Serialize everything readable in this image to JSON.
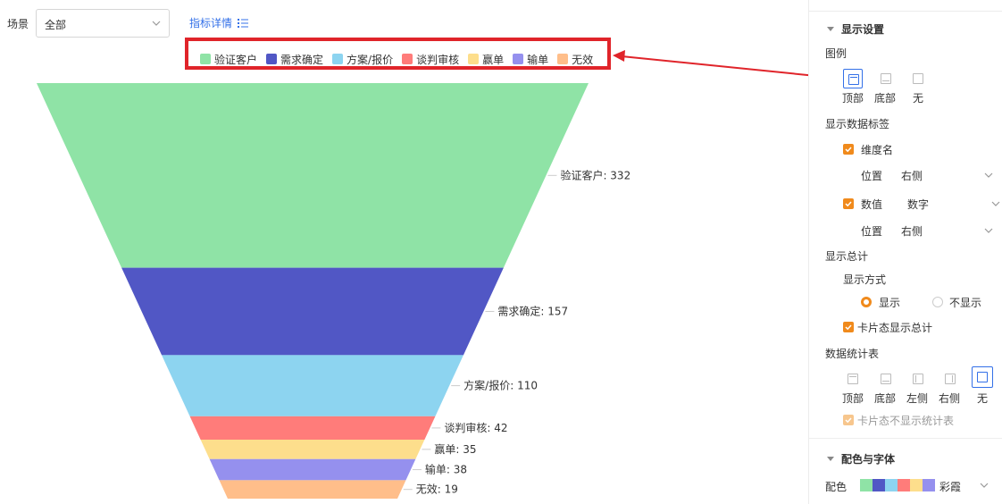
{
  "filter": {
    "label": "场景",
    "value": "全部"
  },
  "detail_link": {
    "label": "指标详情"
  },
  "colors": {
    "accent": "#3370e8",
    "checkbox": "#f08a1c",
    "highlight_box": "#e0242a",
    "annotation_arrow": "#e0242a"
  },
  "chart_data": {
    "type": "funnel",
    "title": "",
    "categories": [
      "验证客户",
      "需求确定",
      "方案/报价",
      "谈判审核",
      "赢单",
      "输单",
      "无效"
    ],
    "values": [
      332,
      157,
      110,
      42,
      35,
      38,
      19
    ],
    "colors": [
      "#8fe3a6",
      "#5157c5",
      "#8dd4f0",
      "#ff7c7a",
      "#fdde8c",
      "#9590ee",
      "#ffbe8a"
    ],
    "labels": [
      "验证客户: 332",
      "需求确定: 157",
      "方案/报价: 110",
      "谈判审核: 42",
      "赢单: 35",
      "输单: 38",
      "无效: 19"
    ],
    "legend_position": "top",
    "data_label_position": "right",
    "grid": false
  },
  "panel": {
    "display_settings": {
      "title": "显示设置",
      "legend": {
        "label": "图例",
        "options": [
          "顶部",
          "底部",
          "无"
        ],
        "selected": "顶部"
      },
      "data_labels": {
        "label": "显示数据标签",
        "dimension_name": {
          "label": "维度名",
          "checked": true
        },
        "position_1": {
          "label": "位置",
          "value": "右侧"
        },
        "value": {
          "label": "数值",
          "checked": true,
          "format": "数字"
        },
        "position_2": {
          "label": "位置",
          "value": "右侧"
        }
      },
      "total": {
        "label": "显示总计",
        "mode_label": "显示方式",
        "options": [
          "显示",
          "不显示"
        ],
        "selected": "显示",
        "card_total": {
          "label": "卡片态显示总计",
          "checked": true
        }
      },
      "stats_table": {
        "label": "数据统计表",
        "options": [
          "顶部",
          "底部",
          "左侧",
          "右侧",
          "无"
        ],
        "selected": "无",
        "card_hide": {
          "label": "卡片态不显示统计表",
          "checked": true
        }
      }
    },
    "color_font": {
      "title": "配色与字体",
      "palette_label": "配色",
      "palette_name": "彩霞",
      "palette_swatches": [
        "#8fe3a6",
        "#5157c5",
        "#8dd4f0",
        "#ff7c7a",
        "#fdde8c",
        "#9590ee"
      ]
    }
  }
}
